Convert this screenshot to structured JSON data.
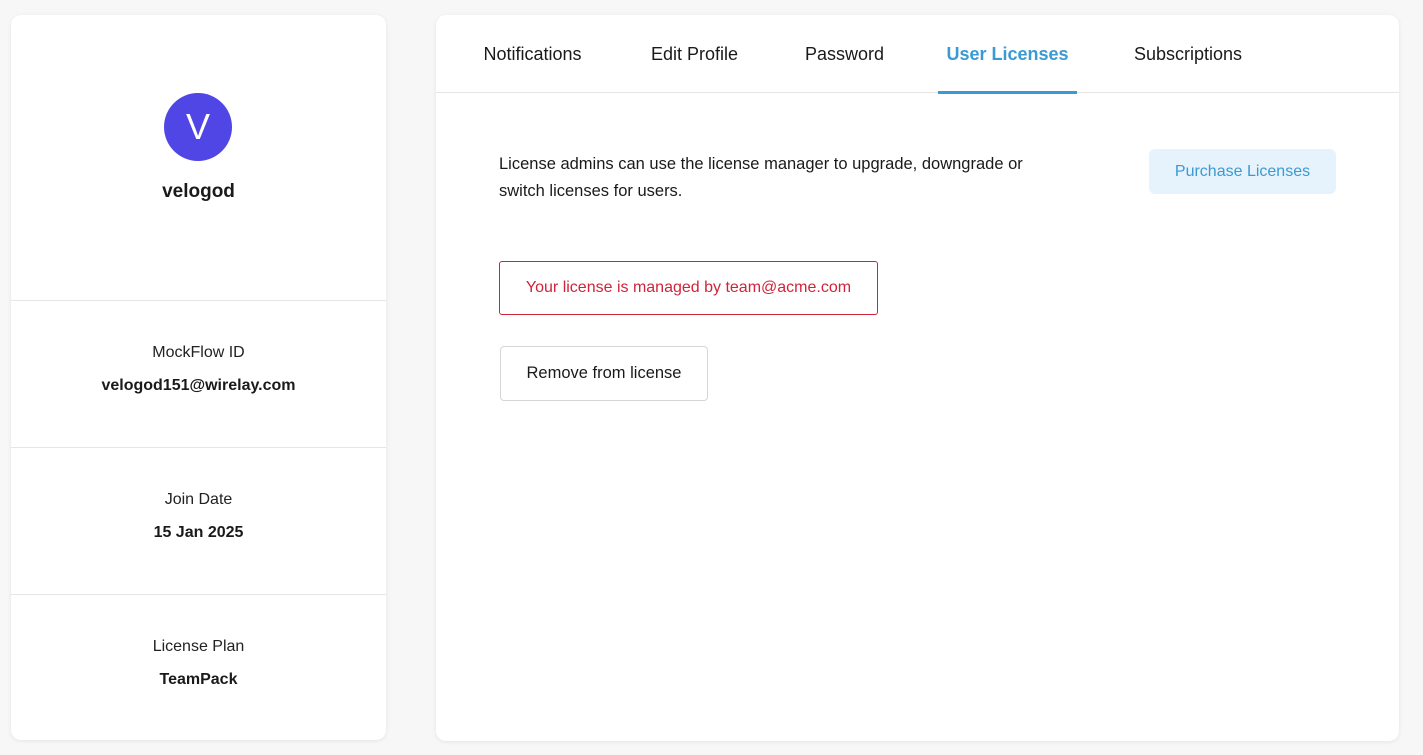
{
  "profile": {
    "avatar_initial": "V",
    "avatar_color": "#4f46e5",
    "username": "velogod",
    "mockflow_id": {
      "label": "MockFlow ID",
      "value": "velogod151@wirelay.com"
    },
    "join_date": {
      "label": "Join Date",
      "value": "15 Jan 2025"
    },
    "license_plan": {
      "label": "License Plan",
      "value": "TeamPack"
    }
  },
  "tabs": [
    {
      "label": "Notifications",
      "active": false
    },
    {
      "label": "Edit Profile",
      "active": false
    },
    {
      "label": "Password",
      "active": false
    },
    {
      "label": "User Licenses",
      "active": true
    },
    {
      "label": "Subscriptions",
      "active": false
    }
  ],
  "licenses": {
    "description": "License admins can use the license manager to upgrade, downgrade or switch licenses for users.",
    "purchase_label": "Purchase Licenses",
    "managed_notice": "Your license is managed by team@acme.com",
    "remove_label": "Remove from license"
  },
  "colors": {
    "accent": "#3a9ad4",
    "error": "#d0243a"
  }
}
